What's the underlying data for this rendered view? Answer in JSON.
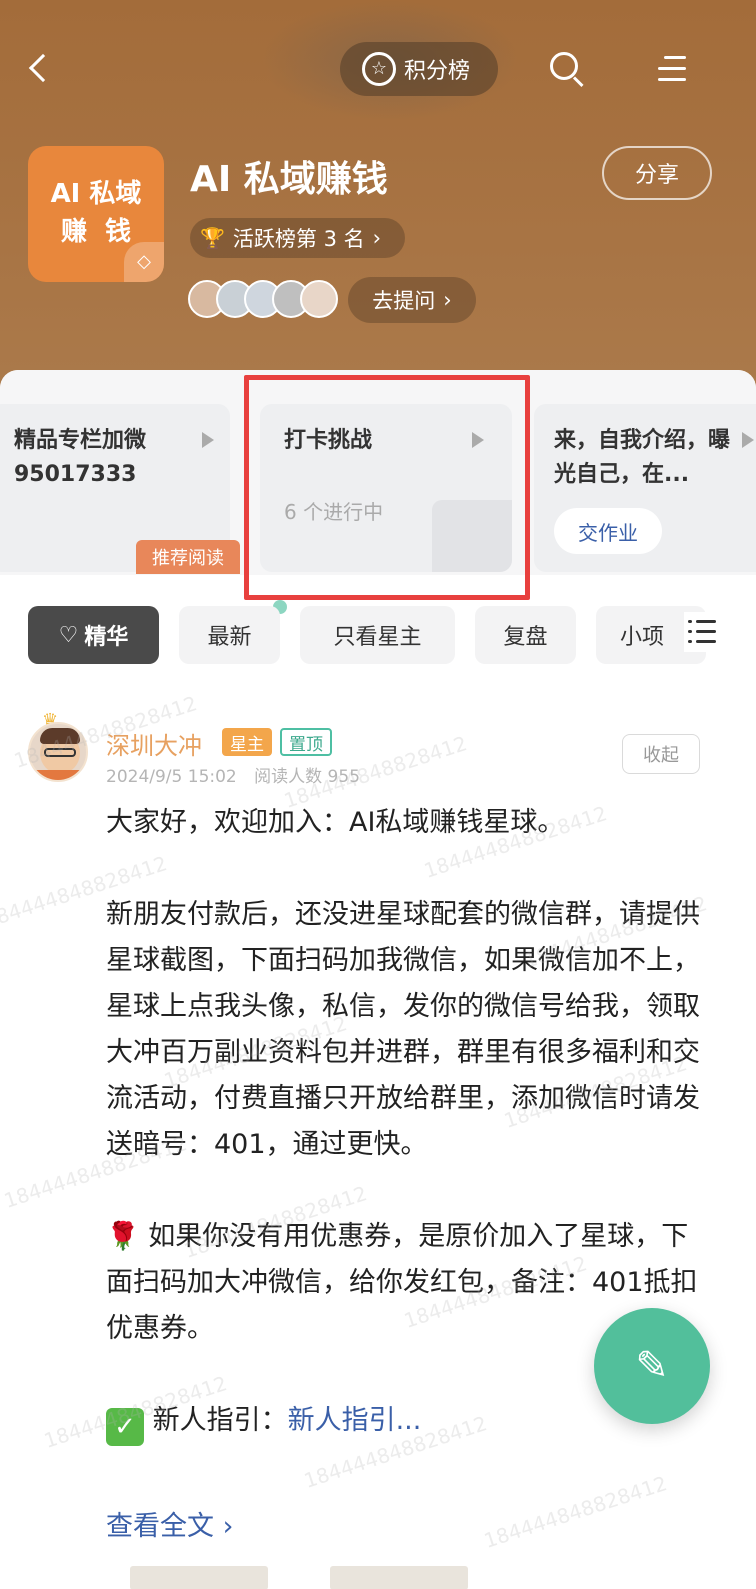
{
  "header": {
    "points_label": "积分榜",
    "group_logo_line1": "AI 私域",
    "group_logo_line2": "赚  钱",
    "group_title": "AI 私域赚钱",
    "share_label": "分享",
    "rank_label": "活跃榜第 3 名",
    "ask_label": "去提问"
  },
  "cards": [
    {
      "title": "精品专栏加微95017333",
      "tag": "推荐阅读"
    },
    {
      "title": "打卡挑战",
      "subtitle": "6 个进行中"
    },
    {
      "title": "来，自我介绍，曝光自己，在...",
      "button": "交作业"
    }
  ],
  "tabs": [
    "精华",
    "最新",
    "只看星主",
    "复盘",
    "小项"
  ],
  "post": {
    "author": "深圳大冲",
    "badge_owner": "星主",
    "badge_pinned": "置顶",
    "date": "2024/9/5 15:02",
    "reads": "阅读人数 955",
    "collapse_label": "收起",
    "para1": "大家好，欢迎加入：AI私域赚钱星球。",
    "para2": "新朋友付款后，还没进星球配套的微信群，请提供星球截图，下面扫码加我微信，如果微信加不上，星球上点我头像，私信，发你的微信号给我，领取大冲百万副业资料包并进群，群里有很多福利和交流活动，付费直播只开放给群里，添加微信时请发送暗号：401，通过更快。",
    "para3": "如果你没有用优惠券，是原价加入了星球，下面扫码加大冲微信，给你发红包，备注：401抵扣优惠券。",
    "guide_prefix": "新人指引：",
    "guide_link": "新人指引...",
    "read_more": "查看全文 ›"
  },
  "watermark": "184444848828412",
  "colors": {
    "header_bg": "#a87444",
    "accent_green": "#52bf9b",
    "link_blue": "#3a5fa8",
    "highlight_red": "#e8403e"
  }
}
